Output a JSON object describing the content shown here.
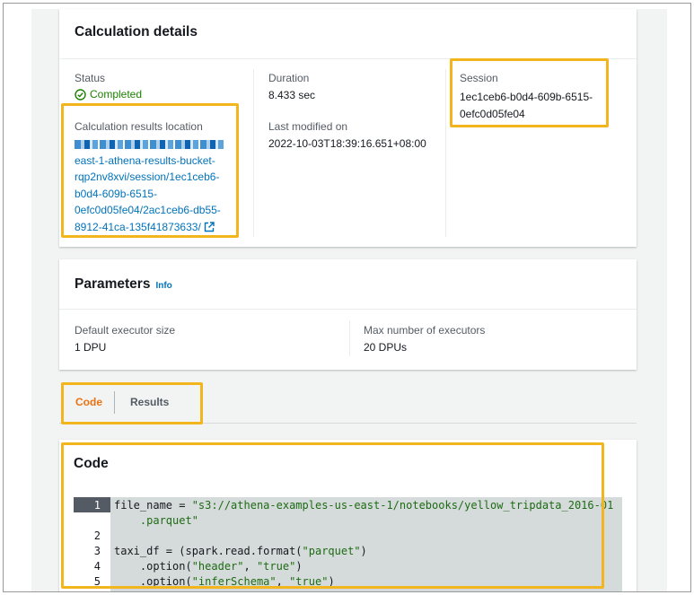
{
  "calculation_details": {
    "title": "Calculation details",
    "status_label": "Status",
    "status_value": "Completed",
    "results_location_label": "Calculation results location",
    "results_location_lines": [
      "east-1-athena-results-bucket-",
      "rqp2nv8xvi/session/1ec1ceb6-",
      "b0d4-609b-6515-",
      "0efc0d05fe04/2ac1ceb6-db55-",
      "8912-41ca-135f41873633/"
    ],
    "duration_label": "Duration",
    "duration_value": "8.433 sec",
    "last_modified_label": "Last modified on",
    "last_modified_value": "2022-10-03T18:39:16.651+08:00",
    "session_label": "Session",
    "session_value_lines": [
      "1ec1ceb6-b0d4-609b-6515-",
      "0efc0d05fe04"
    ]
  },
  "parameters": {
    "title": "Parameters",
    "info_link": "Info",
    "executor_size_label": "Default executor size",
    "executor_size_value": "1 DPU",
    "max_executors_label": "Max number of executors",
    "max_executors_value": "20 DPUs"
  },
  "tabs": {
    "code": "Code",
    "results": "Results"
  },
  "code_panel": {
    "title": "Code",
    "line_numbers": [
      "1",
      "2",
      "3",
      "4",
      "5"
    ],
    "lines": {
      "l1_a": "file_name = ",
      "l1_b": "\"s3://athena-examples-us-east-1/notebooks/yellow_tripdata_2016-01",
      "l1c": "    .parquet\"",
      "l3_a": "taxi_df = (spark.read.format(",
      "l3_b": "\"parquet\"",
      "l3_c": ")",
      "l4_a": "    .option(",
      "l4_b": "\"header\"",
      "l4_c": ", ",
      "l4_d": "\"true\"",
      "l4_e": ")",
      "l5_a": "    .option(",
      "l5_b": "\"inferSchema\"",
      "l5_c": ", ",
      "l5_d": "\"true\"",
      "l5_e": ")"
    }
  },
  "colors": {
    "highlight": "#f2b51d",
    "link": "#0073bb",
    "success": "#1d8102",
    "active_tab": "#ec7211"
  }
}
